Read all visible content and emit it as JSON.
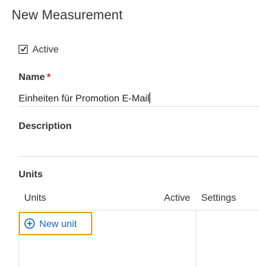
{
  "header": {
    "title": "New Measurement"
  },
  "form": {
    "active": {
      "label": "Active",
      "checked": true
    },
    "name": {
      "label": "Name",
      "required_mark": "*",
      "value": "Einheiten für Promotion E-Mail"
    },
    "description": {
      "label": "Description",
      "value": ""
    }
  },
  "units_section": {
    "heading": "Units",
    "columns": [
      "Units",
      "Active",
      "Settings"
    ],
    "new_unit_label": "New unit"
  },
  "icons": {
    "checkbox": "checkmark-icon",
    "new_unit": "plus-circle-icon"
  },
  "colors": {
    "accent": "#1c64b8",
    "focus_border": "#e8a317",
    "required": "#c0282f"
  }
}
